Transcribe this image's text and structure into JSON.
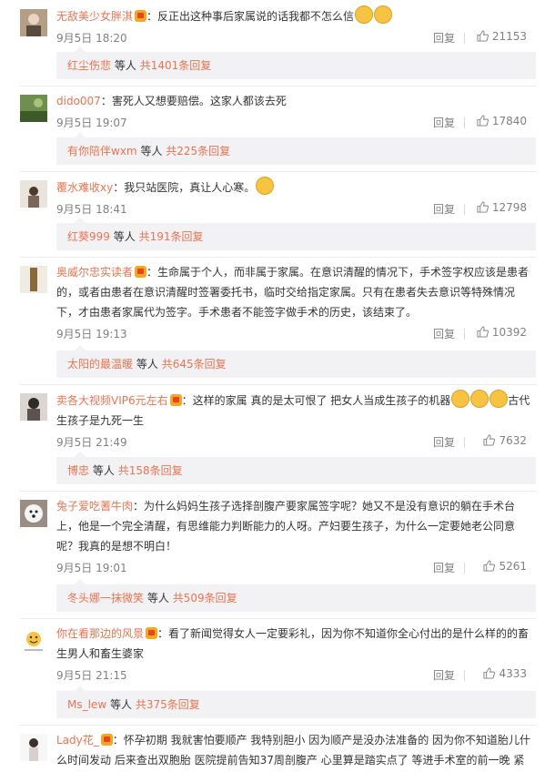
{
  "comments": [
    {
      "username": "无敌美少女胖淇",
      "text": "：反正出这种事后家属说的话我都不怎么信",
      "time": "9月5日 18:20",
      "reply": "回复",
      "likes": "21153",
      "sub_user": "红尘伤悲",
      "sub_mid": "等人",
      "sub_count": "共1401条回复"
    },
    {
      "username": "dido007",
      "text": "：害死人又想要赔偿。这家人都该去死",
      "time": "9月5日 19:07",
      "reply": "回复",
      "likes": "17840",
      "sub_user": "有你陪伴wxm",
      "sub_mid": "等人",
      "sub_count": "共225条回复"
    },
    {
      "username": "覆水难收xy",
      "text": "：我只站医院，真让人心寒。",
      "time": "9月5日 18:41",
      "reply": "回复",
      "likes": "12798",
      "sub_user": "红葵999",
      "sub_mid": "等人",
      "sub_count": "共191条回复"
    },
    {
      "username": "奥威尔忠实读者",
      "text": "：生命属于个人，而非属于家属。在意识清醒的情况下，手术签字权应该是患者的，或者由患者在意识清醒时签署委托书，临时交给指定家属。只有在患者失去意识等特殊情况下，才由患者家属代为签字。手术患者不能签字做手术的历史，该结束了。",
      "time": "9月5日 19:13",
      "reply": "回复",
      "likes": "10392",
      "sub_user": "太阳的最温暖",
      "sub_mid": "等人",
      "sub_count": "共645条回复"
    },
    {
      "username": "卖各大视频VIP6元左右",
      "text": "：这样的家属 真的是太可恨了 把女人当成生孩子的机器",
      "text2": "古代生孩子是九死一生",
      "time": "9月5日 21:49",
      "reply": "回复",
      "likes": "7632",
      "sub_user": "博忠",
      "sub_mid": "等人",
      "sub_count": "共158条回复"
    },
    {
      "username": "兔子爱吃蓍牛肉",
      "text": "：为什么妈妈生孩子选择剖腹产要家属签字呢？她又不是没有意识的躺在手术台上，他是一个完全清醒，有思维能力判断能力的人呀。产妇要生孩子，为什么一定要她老公同意呢？我真的是想不明白！",
      "time": "9月5日 19:01",
      "reply": "回复",
      "likes": "5261",
      "sub_user": "冬头娜一抹微笑",
      "sub_mid": "等人",
      "sub_count": "共509条回复"
    },
    {
      "username": "你在看那边的风景",
      "text": "：看了新闻觉得女人一定要彩礼，因为你不知道你全心付出的是什么样的的畜生男人和畜生婆家",
      "time": "9月5日 21:15",
      "reply": "回复",
      "likes": "4333",
      "sub_user": "Ms_lew",
      "sub_mid": "等人",
      "sub_count": "共375条回复"
    },
    {
      "username": "Lady花_",
      "text": "：怀孕初期 我就害怕要顺产 我特别胆小 因为顺产是没办法准备的 因为你不知道胎儿什么时间发动 后来查出双胞胎 医院提前告知37周剖腹产 心里算是踏实点了 等进手术室的前一晚 紧",
      "time": "",
      "reply": "",
      "likes": ""
    }
  ],
  "colors": {
    "username": "#eb7350",
    "text": "#333333",
    "meta": "#808080",
    "sub_bg": "#f2f2f5"
  },
  "icons": [
    "vip-crown-icon",
    "emoji-icon",
    "thumbs-up-icon"
  ]
}
